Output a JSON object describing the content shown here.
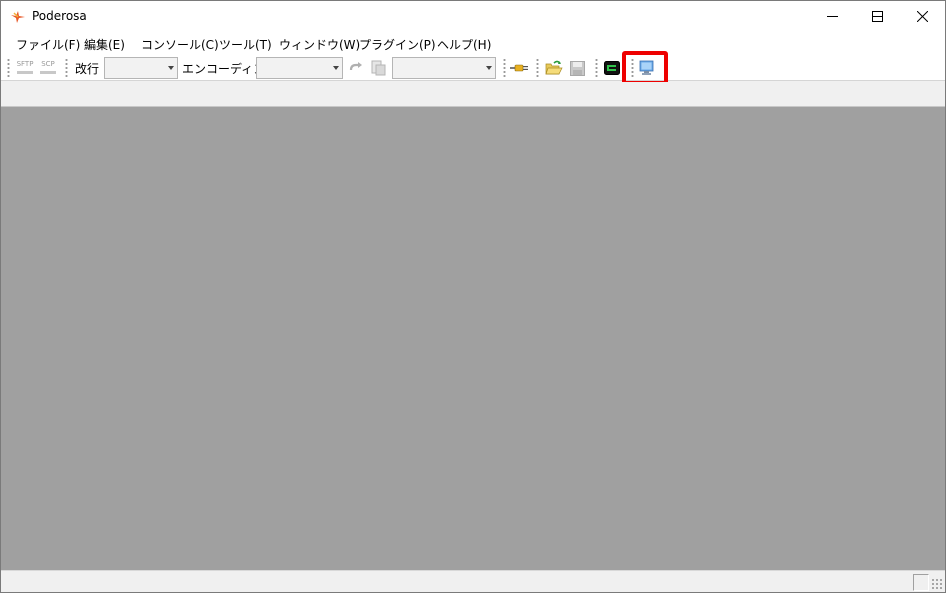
{
  "window": {
    "title": "Poderosa",
    "icon": "poderosa-star-icon"
  },
  "title_buttons": {
    "minimize": "minimize-icon",
    "maximize": "maximize-icon",
    "close": "close-icon"
  },
  "menu": {
    "items": [
      {
        "label": "ファイル(F)"
      },
      {
        "label": "編集(E)"
      },
      {
        "label": "コンソール(C)"
      },
      {
        "label": "ツール(T)"
      },
      {
        "label": "ウィンドウ(W)"
      },
      {
        "label": "プラグイン(P)"
      },
      {
        "label": "ヘルプ(H)"
      }
    ]
  },
  "toolbar": {
    "sftp_label": "SFTP",
    "scp_label": "SCP",
    "newline_label": "改行",
    "newline_value": "",
    "encoding_label": "エンコーディング",
    "encoding_value": "",
    "shell_value": "",
    "icons": {
      "connect": "plug-icon",
      "open": "folder-open-icon",
      "save": "save-disk-icon",
      "terminal": "terminal-green-icon",
      "window": "window-monitor-icon",
      "reproduce": "reproduce-arrow-icon",
      "macro": "document-icon"
    },
    "highlight_color": "#ee0000"
  },
  "colors": {
    "client_background": "#a0a0a0",
    "chrome": "#f0f0f0"
  }
}
